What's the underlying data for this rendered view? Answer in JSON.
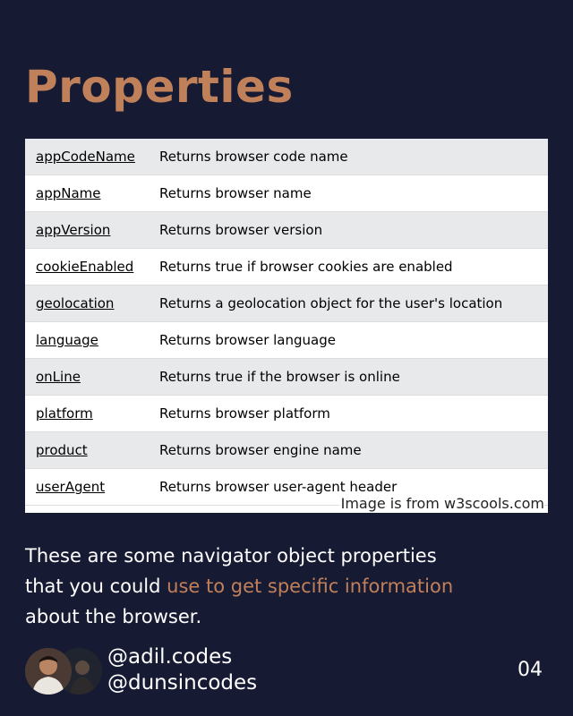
{
  "title": "Properties",
  "table": {
    "rows": [
      {
        "property": "appCodeName",
        "description": "Returns browser code name"
      },
      {
        "property": "appName",
        "description": "Returns browser name"
      },
      {
        "property": "appVersion",
        "description": "Returns browser version"
      },
      {
        "property": "cookieEnabled",
        "description": "Returns true if browser cookies are enabled"
      },
      {
        "property": "geolocation",
        "description": "Returns a geolocation object for the user's location"
      },
      {
        "property": "language",
        "description": "Returns browser language"
      },
      {
        "property": "onLine",
        "description": "Returns true if the browser is online"
      },
      {
        "property": "platform",
        "description": "Returns browser platform"
      },
      {
        "property": "product",
        "description": "Returns browser engine name"
      },
      {
        "property": "userAgent",
        "description": "Returns browser user-agent header"
      }
    ],
    "credit": "Image is from w3scools.com"
  },
  "caption": {
    "part1": "These are some navigator object properties that you could ",
    "highlight": "use to get specific information",
    "part2": " about the browser."
  },
  "footer": {
    "handle1": "@adil.codes",
    "handle2": "@dunsincodes",
    "page_number": "04"
  },
  "colors": {
    "background": "#171a33",
    "accent": "#c0805a",
    "row_alt": "#e7e9eb"
  }
}
